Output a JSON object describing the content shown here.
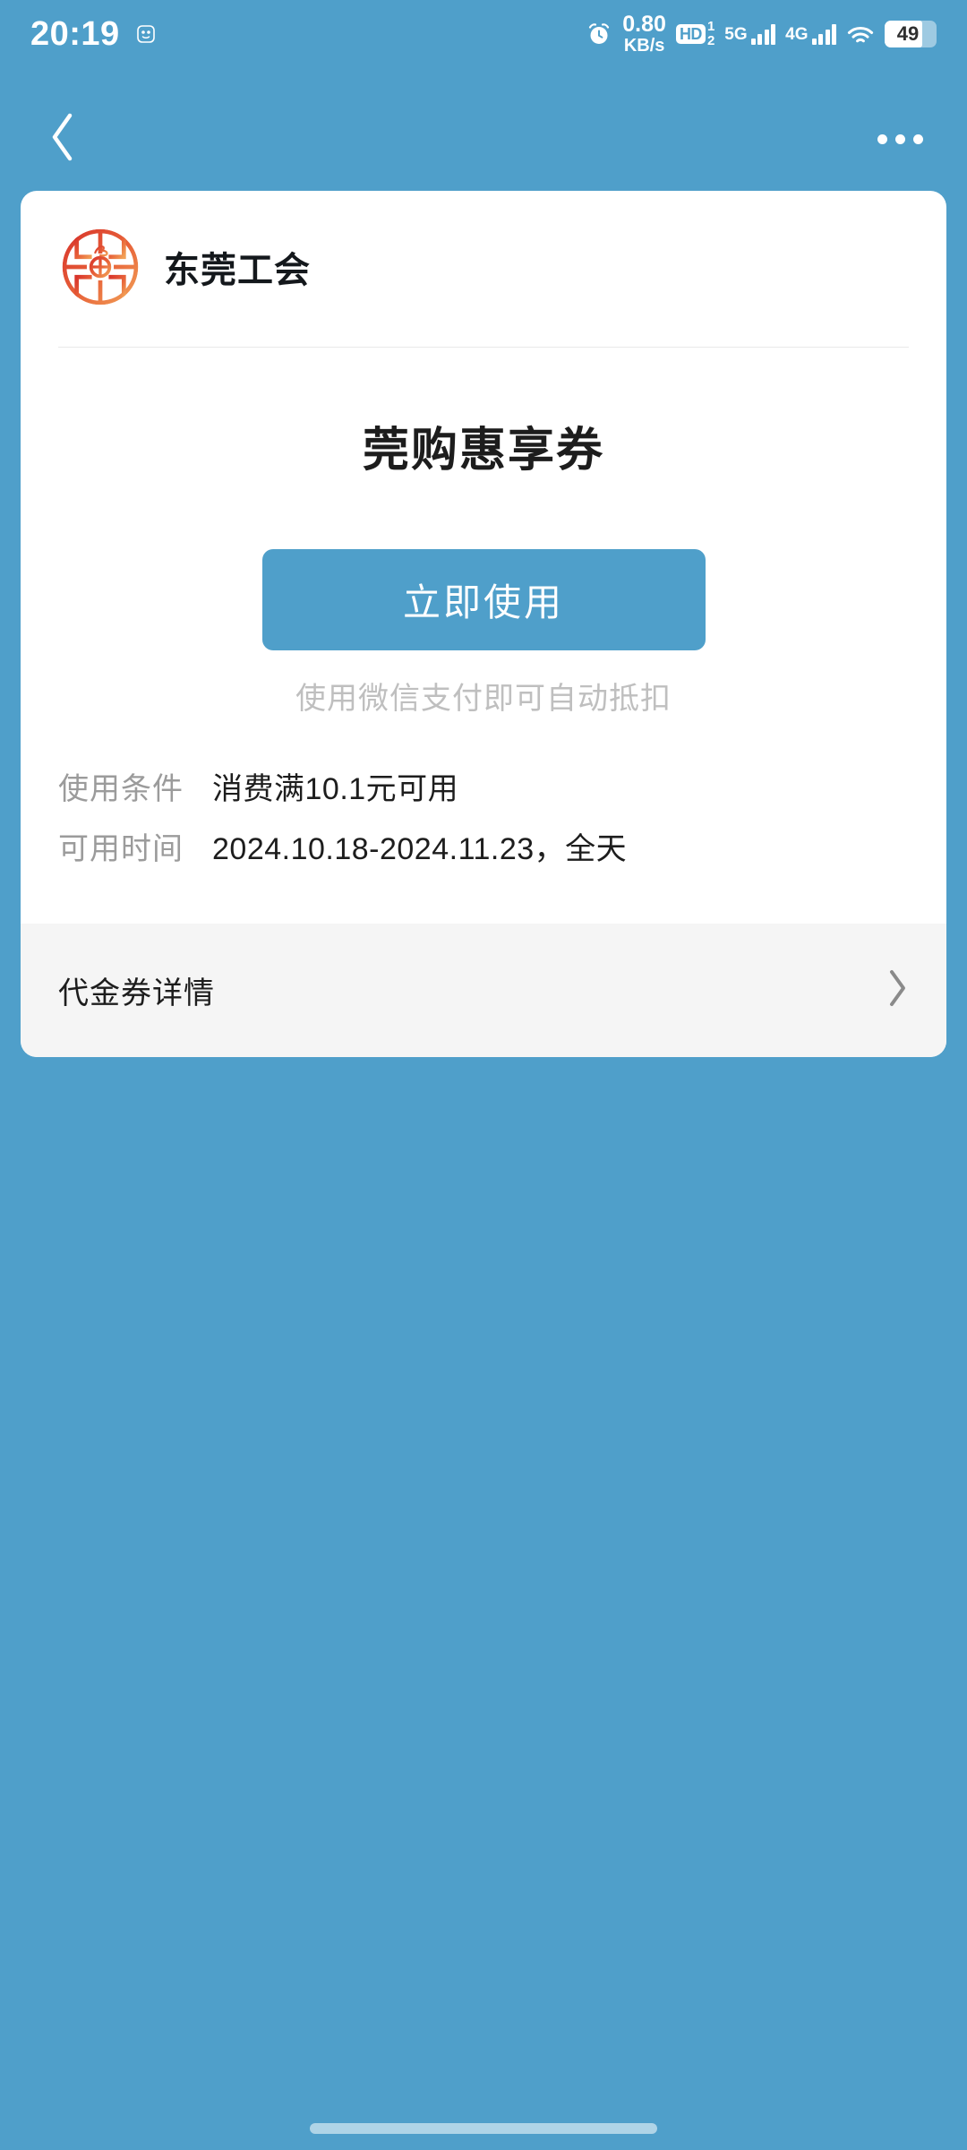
{
  "theme": {
    "background": "#4f9fca",
    "card_background": "#ffffff",
    "footer_background": "#f5f5f5",
    "button_color": "#4f9fca",
    "brand_logo_color": "#d93a2b",
    "brand_logo_color_2": "#f0924a"
  },
  "status_bar": {
    "time": "20:19",
    "face_icon": "smiley-face-icon",
    "alarm_icon": "alarm-clock-icon",
    "network_speed_value": "0.80",
    "network_speed_unit": "KB/s",
    "hd_label": "HD",
    "sim_1": "1",
    "sim_2": "2",
    "signal_1_label": "5G",
    "signal_1_bars": 4,
    "signal_2_label": "4G",
    "signal_2_bars": 4,
    "wifi_icon": "wifi-icon",
    "battery_level": "49"
  },
  "nav_bar": {
    "back_icon": "chevron-left-icon",
    "more_icon": "more-horizontal-icon"
  },
  "card": {
    "brand": {
      "logo_icon": "dongguan-union-logo-icon",
      "name": "东莞工会"
    },
    "coupon_title": "莞购惠享券",
    "cta_label": "立即使用",
    "cta_hint": "使用微信支付即可自动抵扣",
    "details": [
      {
        "label": "使用条件",
        "value": "消费满10.1元可用"
      },
      {
        "label": "可用时间",
        "value": "2024.10.18-2024.11.23，全天"
      }
    ],
    "footer": {
      "label": "代金券详情",
      "chevron_icon": "chevron-right-icon"
    }
  },
  "system": {
    "home_indicator": "home-indicator-bar"
  }
}
